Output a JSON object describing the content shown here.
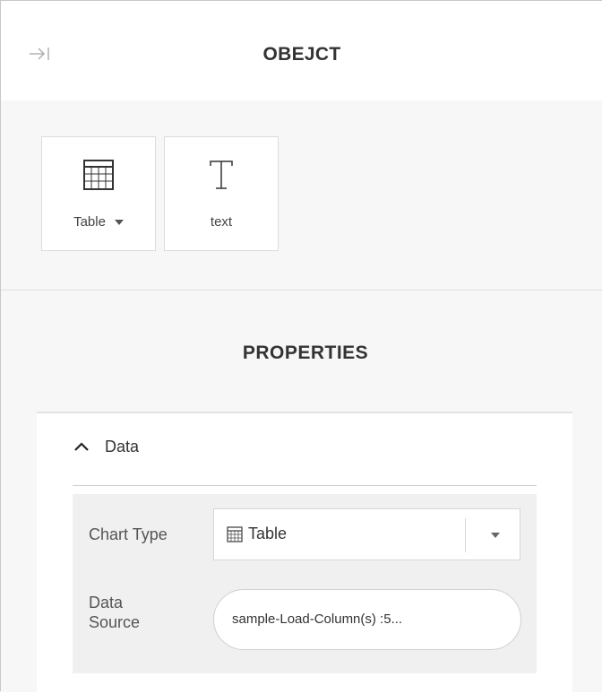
{
  "header": {
    "title": "OBEJCT",
    "collapse_icon": "collapse-right-icon"
  },
  "objects": [
    {
      "label": "Table",
      "icon": "table-icon",
      "has_dropdown": true
    },
    {
      "label": "text",
      "icon": "text-icon",
      "has_dropdown": false
    }
  ],
  "properties": {
    "title": "PROPERTIES",
    "section": {
      "label": "Data",
      "expanded": true,
      "chart_type": {
        "label": "Chart Type",
        "value": "Table"
      },
      "data_source": {
        "label_line1": "Data",
        "label_line2": "Source",
        "value": "sample-Load-Column(s) :5..."
      }
    }
  }
}
